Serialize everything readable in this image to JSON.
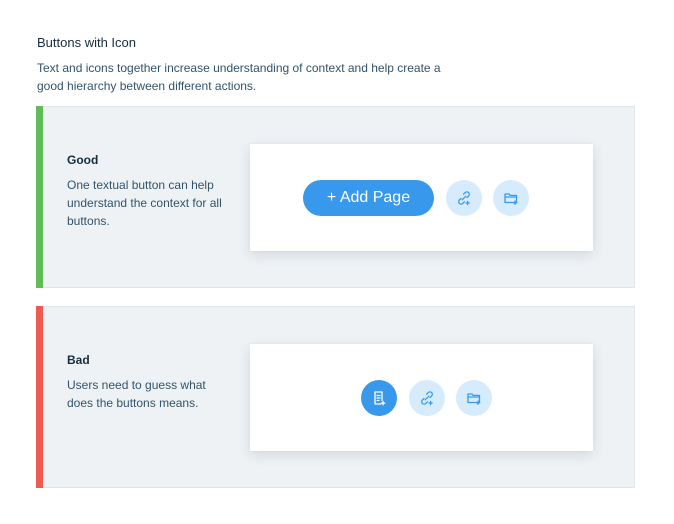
{
  "header": {
    "title": "Buttons with Icon",
    "description": "Text and icons together increase understanding of context and help create a good hierarchy between different actions."
  },
  "examples": {
    "good": {
      "title": "Good",
      "description": "One textual button can help understand the context for all buttons.",
      "accent_color": "#60bc57",
      "primary_button_label": "+ Add Page",
      "icons": [
        "link-icon",
        "add-folder-icon"
      ]
    },
    "bad": {
      "title": "Bad",
      "description": "Users need to guess what does the buttons means.",
      "accent_color": "#ee5951",
      "icons": [
        "add-page-icon",
        "link-icon",
        "add-folder-icon"
      ]
    }
  },
  "colors": {
    "primary": "#3899ec",
    "secondary_bg": "#d6ecfc",
    "card_bg": "#eef2f5",
    "text_dark": "#162d3d",
    "text_body": "#32536a"
  }
}
